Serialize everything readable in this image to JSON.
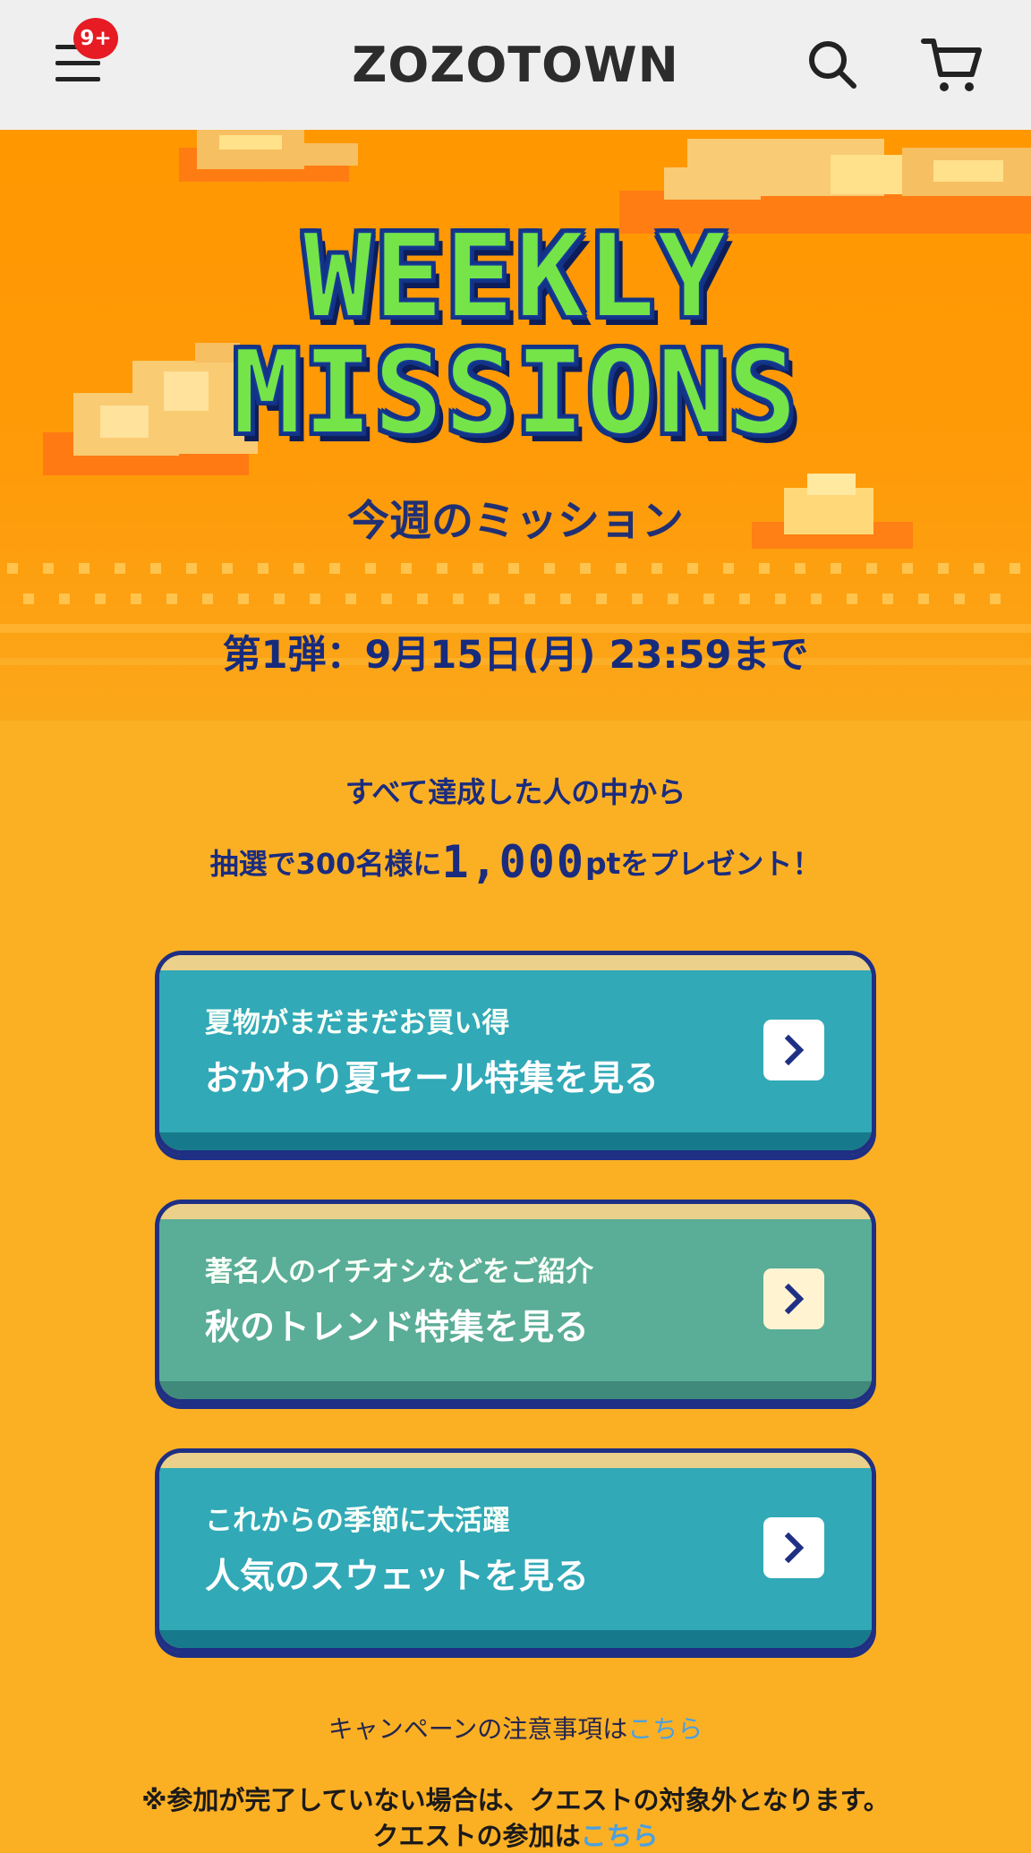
{
  "header": {
    "menu_badge": "9+",
    "brand": "ZOZOTOWN",
    "icons": [
      "menu-icon",
      "search-icon",
      "cart-icon"
    ]
  },
  "campaign": {
    "title_line_1": "WEEKLY",
    "title_line_2": "MISSIONS",
    "subtitle": "今週のミッション",
    "round": "第1弾：9月15日(月) 23:59まで",
    "prize_line_1": "すべて達成した人の中から",
    "prize_prefix": "抽選で300名様に",
    "prize_amount": "1,000",
    "prize_unit": "pt",
    "prize_suffix": "をプレゼント！"
  },
  "missions": [
    {
      "subtext": "夏物がまだまだお買い得",
      "label": "おかわり夏セール特集を見る"
    },
    {
      "subtext": "著名人のイチオシなどをご紹介",
      "label": "秋のトレンド特集を見る"
    },
    {
      "subtext": "これからの季節に大活躍",
      "label": "人気のスウェットを見る"
    }
  ],
  "notice": {
    "text": "キャンペーンの注意事項は",
    "link": "こちら"
  },
  "footer_note": {
    "line_1": "※参加が完了していない場合は、クエストの対象外となります。",
    "line_2_prefix": "クエストの参加は",
    "line_2_link": "こちら"
  },
  "colors": {
    "header_bg": "#efefef",
    "page_bg": "#fbb024",
    "accent_blue": "#1e2f84",
    "button_blue": "#31a9b7",
    "button_green": "#5aad96",
    "badge_red": "#e61b23"
  }
}
